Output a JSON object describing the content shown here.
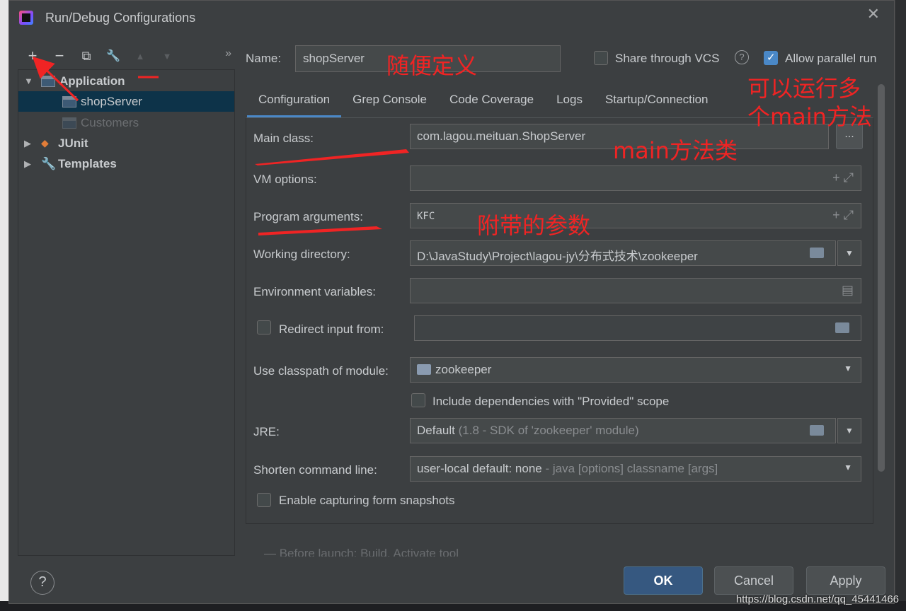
{
  "window": {
    "title": "Run/Debug Configurations",
    "close": "✕"
  },
  "toolbar": {
    "add": "+",
    "remove": "−",
    "copy": "⧉",
    "edit": "🔧",
    "up": "▲",
    "down": "▼",
    "more": "»"
  },
  "tree": {
    "application": "Application",
    "shop_server": "shopServer",
    "customers": "Customers",
    "junit": "JUnit",
    "templates": "Templates"
  },
  "header": {
    "name_label": "Name:",
    "name_value": "shopServer",
    "share_vcs": "Share through VCS",
    "allow_parallel": "Allow parallel run"
  },
  "tabs": [
    "Configuration",
    "Grep Console",
    "Code Coverage",
    "Logs",
    "Startup/Connection"
  ],
  "form": {
    "main_class_label": "Main class:",
    "main_class_value": "com.lagou.meituan.ShopServer",
    "vm_options_label": "VM options:",
    "program_args_label": "Program arguments:",
    "program_args_value": "KFC",
    "working_dir_label": "Working directory:",
    "working_dir_value": "D:\\JavaStudy\\Project\\lagou-jy\\分布式技术\\zookeeper",
    "env_vars_label": "Environment variables:",
    "redirect_label": "Redirect input from:",
    "classpath_label": "Use classpath of module:",
    "classpath_value": "zookeeper",
    "include_deps": "Include dependencies with \"Provided\" scope",
    "jre_label": "JRE:",
    "jre_value": "Default",
    "jre_hint": "(1.8 - SDK of 'zookeeper' module)",
    "shorten_label": "Shorten command line:",
    "shorten_value": "user-local default: none",
    "shorten_hint": "- java [options] classname [args]",
    "snapshots": "Enable capturing form snapshots",
    "cut_text": "— Before launch: Build, Activate tool window"
  },
  "buttons": {
    "help": "?",
    "ok": "OK",
    "cancel": "Cancel",
    "apply": "Apply",
    "browse": "..."
  },
  "annotations": {
    "name": "随便定义",
    "parallel_1": "可以运行多",
    "parallel_2": "个main方法",
    "main_class": "main方法类",
    "args": "附带的参数"
  },
  "watermark": "https://blog.csdn.net/qq_45441466",
  "colors": {
    "accent": "#4a88c7",
    "annotation": "#f02424",
    "selection": "#0d3349"
  }
}
